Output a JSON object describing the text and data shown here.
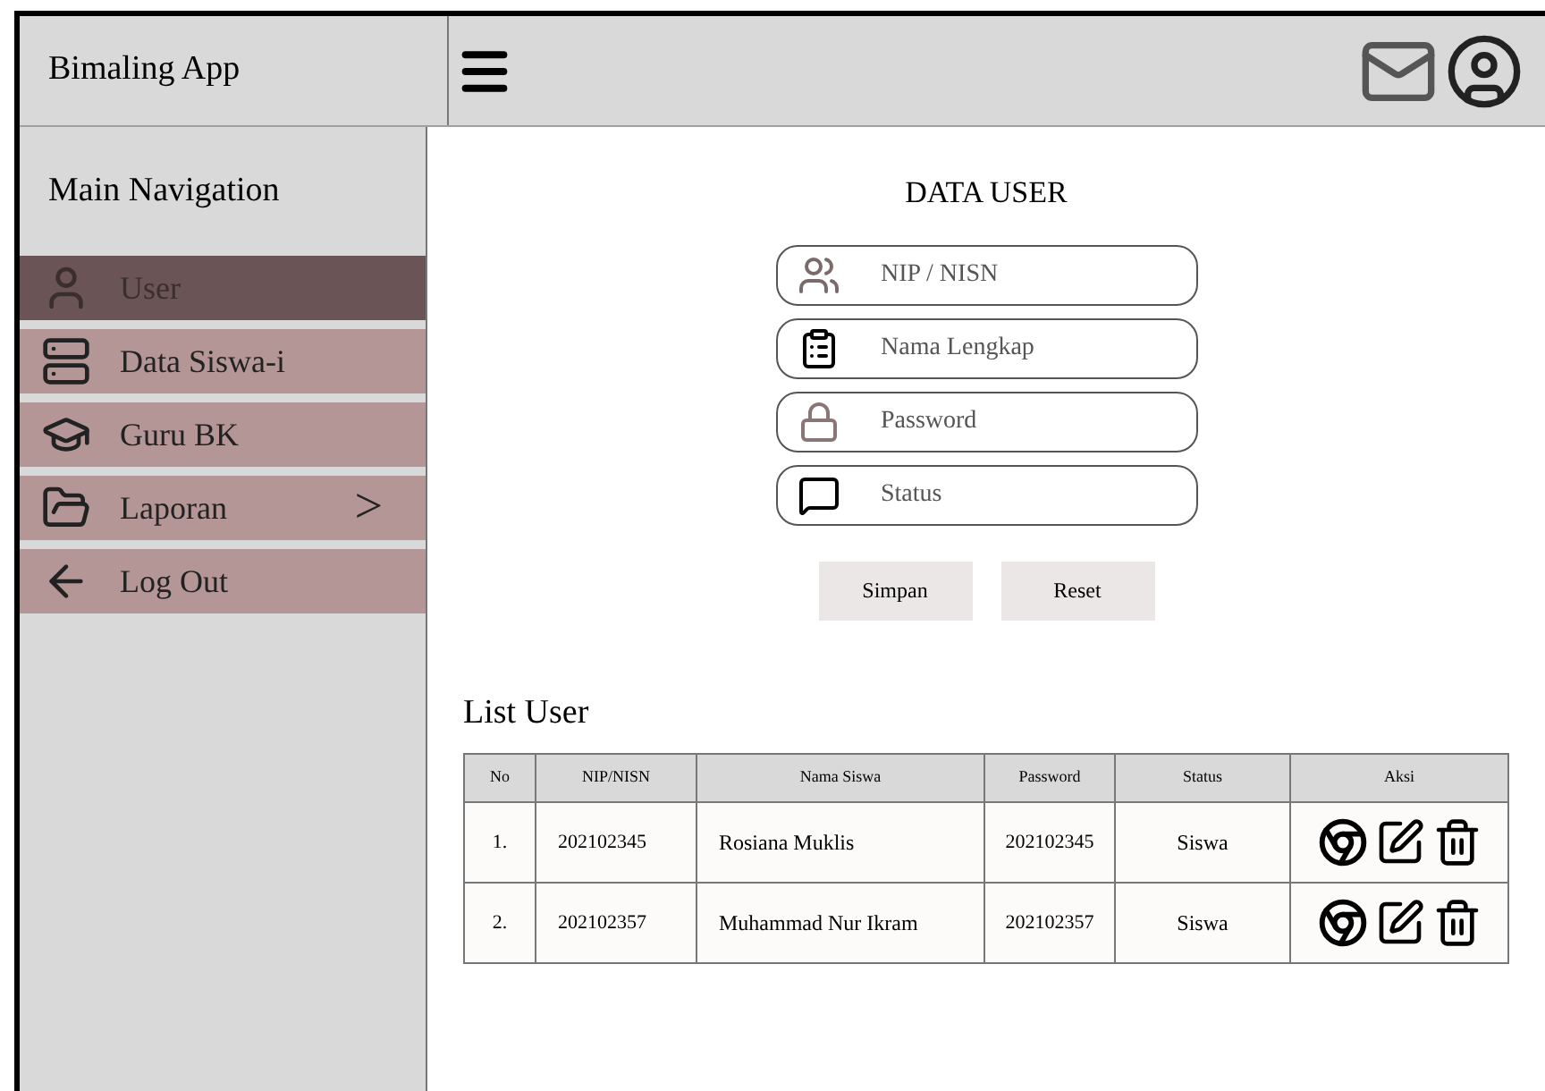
{
  "app_title": "Bimaling App",
  "sidebar": {
    "heading": "Main Navigation",
    "items": [
      {
        "label": "User",
        "kind": "user",
        "selected": true
      },
      {
        "label": "Data Siswa-i",
        "kind": "data",
        "selected": false
      },
      {
        "label": "Guru BK",
        "kind": "guru",
        "selected": false
      },
      {
        "label": "Laporan",
        "kind": "folder",
        "selected": false,
        "arrow": ">"
      },
      {
        "label": "Log Out",
        "kind": "logout",
        "selected": false
      }
    ]
  },
  "form": {
    "title": "DATA USER",
    "fields": [
      {
        "placeholder": "NIP / NISN",
        "kind": "users"
      },
      {
        "placeholder": "Nama Lengkap",
        "kind": "clipboard"
      },
      {
        "placeholder": "Password",
        "kind": "lock"
      },
      {
        "placeholder": "Status",
        "kind": "chat"
      }
    ],
    "buttons": [
      "Simpan",
      "Reset"
    ]
  },
  "table": {
    "title": "List User",
    "columns": [
      "No",
      "NIP/NISN",
      "Nama Siswa",
      "Password",
      "Status",
      "Aksi"
    ],
    "rows": [
      {
        "no": "1.",
        "nip": "202102345",
        "nama": "Rosiana Muklis",
        "password": "202102345",
        "status": "Siswa"
      },
      {
        "no": "2.",
        "nip": "202102357",
        "nama": "Muhammad Nur Ikram",
        "password": "202102357",
        "status": "Siswa"
      }
    ]
  }
}
